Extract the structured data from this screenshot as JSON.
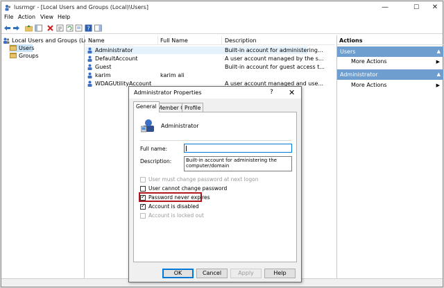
{
  "window": {
    "title": "lusrmgr - [Local Users and Groups (Local)\\Users]",
    "controls": {
      "minimize": "—",
      "maximize": "☐",
      "close": "✕"
    }
  },
  "menu": [
    "File",
    "Action",
    "View",
    "Help"
  ],
  "toolbar": {
    "icons": [
      "back-arrow-icon",
      "forward-arrow-icon",
      "up-folder-icon",
      "show-hide-tree-icon",
      "delete-icon",
      "properties-icon",
      "refresh-icon",
      "export-list-icon",
      "help-icon",
      "show-hide-action-pane-icon"
    ]
  },
  "tree": {
    "root": "Local Users and Groups (Local)",
    "items": [
      "Users",
      "Groups"
    ]
  },
  "list": {
    "columns": [
      "Name",
      "Full Name",
      "Description"
    ],
    "rows": [
      {
        "name": "Administrator",
        "full_name": "",
        "description": "Built-in account for administering..."
      },
      {
        "name": "DefaultAccount",
        "full_name": "",
        "description": "A user account managed by the s..."
      },
      {
        "name": "Guest",
        "full_name": "",
        "description": "Built-in account for guest access t..."
      },
      {
        "name": "karim",
        "full_name": "karim ali",
        "description": ""
      },
      {
        "name": "WDAGUtilityAccount",
        "full_name": "",
        "description": "A user account managed and use..."
      }
    ]
  },
  "actions": {
    "title": "Actions",
    "sections": [
      {
        "header": "Users",
        "item": "More Actions"
      },
      {
        "header": "Administrator",
        "item": "More Actions"
      }
    ],
    "collapse_glyph": "▲",
    "arrow_glyph": "▶"
  },
  "dialog": {
    "title": "Administrator Properties",
    "help_glyph": "?",
    "close_glyph": "✕",
    "tabs": [
      "General",
      "Member Of",
      "Profile"
    ],
    "active_tab": "General",
    "username": "Administrator",
    "full_name_label": "Full name:",
    "full_name_value": "",
    "description_label": "Description:",
    "description_value": "Built-in account for administering the computer/domain",
    "checkboxes": [
      {
        "label": "User must change password at next logon",
        "checked": false,
        "disabled": true
      },
      {
        "label": "User cannot change password",
        "checked": false,
        "disabled": false
      },
      {
        "label": "Password never expires",
        "checked": true,
        "disabled": false
      },
      {
        "label": "Account is disabled",
        "checked": true,
        "disabled": false
      },
      {
        "label": "Account is locked out",
        "checked": false,
        "disabled": true
      }
    ],
    "buttons": {
      "ok": "OK",
      "cancel": "Cancel",
      "apply": "Apply",
      "help": "Help"
    }
  },
  "colors": {
    "action_section": "#6e9ecf",
    "highlight_border": "#b0161e",
    "selection": "#cce4f7"
  }
}
